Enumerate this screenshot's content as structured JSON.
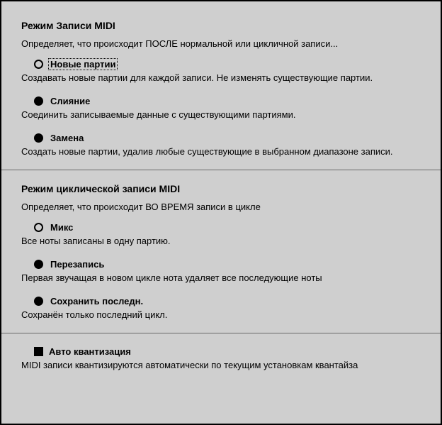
{
  "section1": {
    "title": "Режим Записи MIDI",
    "desc": "Определяет, что происходит ПОСЛЕ нормальной или цикличной записи...",
    "options": [
      {
        "label": "Новые партии",
        "desc": "Создавать новые партии для каждой записи. Не изменять существующие партии."
      },
      {
        "label": "Слияние",
        "desc": "Соединить записываемые данные с существующими партиями."
      },
      {
        "label": "Замена",
        "desc": "Создать новые партии, удалив любые существующие в выбранном диапазоне записи."
      }
    ]
  },
  "section2": {
    "title": "Режим циклической записи MIDI",
    "desc": "Определяет, что происходит ВО ВРЕМЯ записи в цикле",
    "options": [
      {
        "label": "Микс",
        "desc": "Все ноты записаны в одну партию."
      },
      {
        "label": "Перезапись",
        "desc": "Первая звучащая в новом цикле нота удаляет все последующие ноты"
      },
      {
        "label": "Сохранить последн.",
        "desc": "Сохранён только последний цикл."
      }
    ]
  },
  "autoquant": {
    "label": "Авто квантизация",
    "desc": "MIDI записи квантизируются автоматически по текущим установкам квантайза"
  }
}
